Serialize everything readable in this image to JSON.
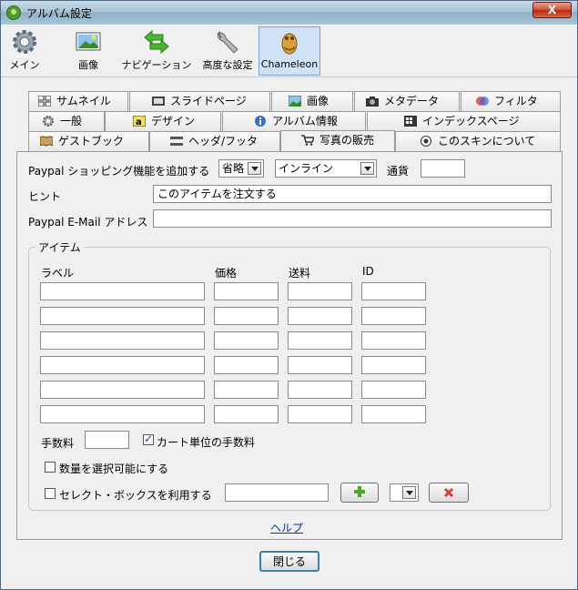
{
  "window": {
    "title": "アルバム設定",
    "close_label": "X"
  },
  "toolbar": {
    "items": [
      {
        "label": "メイン",
        "icon": "gear-icon"
      },
      {
        "label": "画像",
        "icon": "image-icon"
      },
      {
        "label": "ナビゲーション",
        "icon": "arrows-icon"
      },
      {
        "label": "高度な設定",
        "icon": "wrench-icon"
      },
      {
        "label": "Chameleon",
        "icon": "chameleon-icon"
      }
    ]
  },
  "tabs": {
    "row1": [
      "サムネイル",
      "スライドページ",
      "画像",
      "メタデータ",
      "フィルタ"
    ],
    "row2": [
      "一般",
      "デザイン",
      "アルバム情報",
      "インデックスページ"
    ],
    "row3": [
      "ゲストブック",
      "ヘッダ/フッタ",
      "写真の販売",
      "このスキンについて"
    ]
  },
  "form": {
    "paypal_label": "Paypal ショッピング機能を追加する",
    "paypal_option": "省略",
    "paypal_mode": "インライン",
    "currency_label": "通貨",
    "currency_value": "",
    "hint_label": "ヒント",
    "hint_value": "このアイテムを注文する",
    "email_label": "Paypal E-Mail アドレス",
    "email_value": ""
  },
  "items_group": {
    "legend": "アイテム",
    "columns": [
      "ラベル",
      "価格",
      "送料",
      "ID"
    ],
    "rows": [
      [
        "",
        "",
        "",
        ""
      ],
      [
        "",
        "",
        "",
        ""
      ],
      [
        "",
        "",
        "",
        ""
      ],
      [
        "",
        "",
        "",
        ""
      ],
      [
        "",
        "",
        "",
        ""
      ],
      [
        "",
        "",
        "",
        ""
      ]
    ],
    "fee_label": "手数料",
    "fee_value": "",
    "cart_fee_label": "カート単位の手数料",
    "cart_fee_checked": true,
    "qty_label": "数量を選択可能にする",
    "qty_checked": false,
    "select_box_label": "セレクト・ボックスを利用する",
    "select_box_checked": false,
    "select_box_value": ""
  },
  "help_label": "ヘルプ",
  "close_button_label": "閉じる"
}
